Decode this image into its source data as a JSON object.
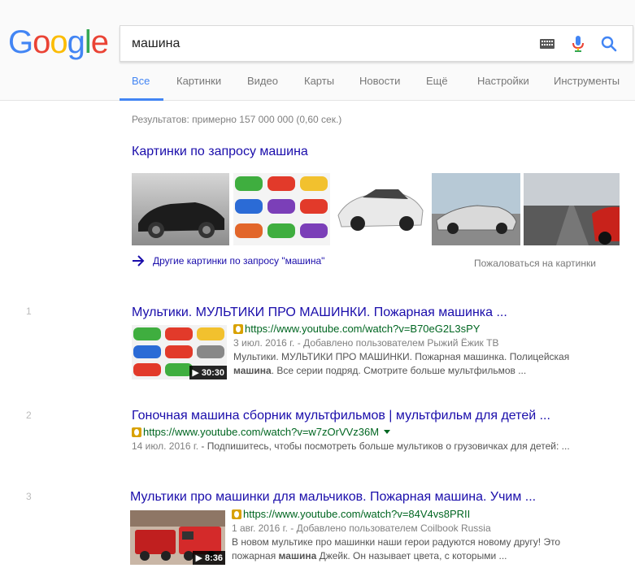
{
  "colors": {
    "link": "#1a0dab",
    "url": "#006621",
    "accent": "#4285f4",
    "muted": "#808080"
  },
  "logo": {
    "letters": [
      "G",
      "o",
      "o",
      "g",
      "l",
      "e"
    ],
    "colors": [
      "#4285f4",
      "#ea4335",
      "#fbbc05",
      "#4285f4",
      "#34a853",
      "#ea4335"
    ]
  },
  "search": {
    "query": "машина"
  },
  "tabs": [
    {
      "label": "Все"
    },
    {
      "label": "Картинки"
    },
    {
      "label": "Видео"
    },
    {
      "label": "Карты"
    },
    {
      "label": "Новости"
    },
    {
      "label": "Ещё"
    },
    {
      "label": "Настройки"
    },
    {
      "label": "Инструменты"
    }
  ],
  "stats": "Результатов: примерно 157 000 000 (0,60 сек.)",
  "images": {
    "heading": "Картинки по запросу машина",
    "more": "Другие картинки по запросу \"машина\"",
    "report": "Пожаловаться на картинки"
  },
  "results": [
    {
      "num": "1",
      "title": "Мультики. МУЛЬТИКИ ПРО МАШИНКИ. Пожарная машинка ...",
      "url": "https://www.youtube.com/watch?v=B70eG2L3sPY",
      "date": "3 июл. 2016 г. - Добавлено пользователем Рыжий Ёжик TB",
      "snippet1": "Мультики. МУЛЬТИКИ ПРО МАШИНКИ. Пожарная машинка. Полицейская",
      "snippet2_bold": "машина",
      "snippet2": ". Все серии подряд. Смотрите больше мультфильмов ...",
      "duration": "30:30"
    },
    {
      "num": "2",
      "title": "Гоночная машина сборник мультфильмов | мультфильм для детей ...",
      "url": "https://www.youtube.com/watch?v=w7zOrVVz36M",
      "date": "14 июл. 2016 г.",
      "snippet1": " - Подпишитесь, чтобы посмотреть больше мультиков о грузовичках для детей: ..."
    },
    {
      "num": "3",
      "title": "Мультики про машинки для мальчиков. Пожарная машина. Учим ...",
      "url": "https://www.youtube.com/watch?v=84V4vs8PRII",
      "date": "1 авг. 2016 г. - Добавлено пользователем Coilbook Russia",
      "snippet1": "В новом мультике про машинки наши герои радуются новому другу! Это",
      "snippet2_pre": "пожарная ",
      "snippet2_bold": "машина",
      "snippet2": " Джейк. Он называет цвета, с которыми ...",
      "duration": "8:36"
    }
  ]
}
